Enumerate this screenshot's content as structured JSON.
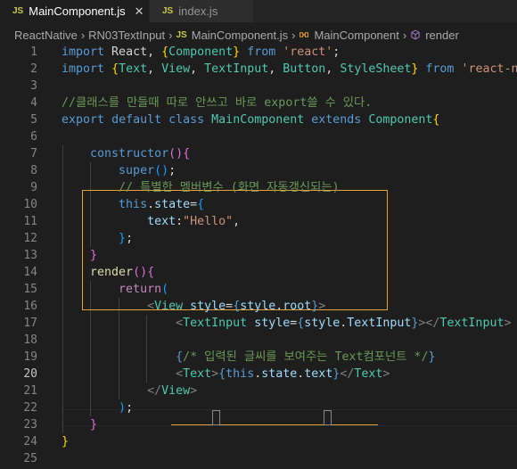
{
  "tabs": [
    {
      "label": "MainComponent.js",
      "icon": "js-file-icon",
      "badge": "JS",
      "active": true
    },
    {
      "label": "index.js",
      "icon": "js-file-icon",
      "badge": "JS",
      "active": false
    }
  ],
  "breadcrumb": {
    "items": [
      "ReactNative",
      "RN03TextInput",
      "MainComponent.js",
      "MainComponent",
      "render"
    ],
    "js_badge": "JS"
  },
  "colors": {
    "background": "#1e1e1e",
    "keyword": "#569cd6",
    "control": "#c586c0",
    "string": "#ce9178",
    "class": "#4ec9b0",
    "function": "#dcdcaa",
    "variable": "#9cdcfe",
    "comment": "#6a9955",
    "highlight_border": "#e5a33a"
  },
  "current_line": 20,
  "lines": [
    {
      "n": 1,
      "tokens": [
        [
          "kw",
          "import"
        ],
        [
          "pl",
          " React, "
        ],
        [
          "brk",
          "{"
        ],
        [
          "cls",
          "Component"
        ],
        [
          "brk",
          "}"
        ],
        [
          "pl",
          " "
        ],
        [
          "kw",
          "from"
        ],
        [
          "pl",
          " "
        ],
        [
          "str",
          "'react'"
        ],
        [
          "pl",
          ";"
        ]
      ]
    },
    {
      "n": 2,
      "tokens": [
        [
          "kw",
          "import"
        ],
        [
          "pl",
          " "
        ],
        [
          "brk",
          "{"
        ],
        [
          "cls",
          "Text"
        ],
        [
          "pl",
          ", "
        ],
        [
          "cls",
          "View"
        ],
        [
          "pl",
          ", "
        ],
        [
          "cls",
          "TextInput"
        ],
        [
          "pl",
          ", "
        ],
        [
          "cls",
          "Button"
        ],
        [
          "pl",
          ", "
        ],
        [
          "cls",
          "StyleSheet"
        ],
        [
          "brk",
          "}"
        ],
        [
          "pl",
          " "
        ],
        [
          "kw",
          "from"
        ],
        [
          "pl",
          " "
        ],
        [
          "str",
          "'react-nati"
        ]
      ]
    },
    {
      "n": 3,
      "tokens": []
    },
    {
      "n": 4,
      "tokens": [
        [
          "cmt",
          "//클래스를 만들때 따로 안쓰고 바로 export쓸 수 있다."
        ]
      ]
    },
    {
      "n": 5,
      "tokens": [
        [
          "kw",
          "export"
        ],
        [
          "pl",
          " "
        ],
        [
          "kw",
          "default"
        ],
        [
          "pl",
          " "
        ],
        [
          "kw",
          "class"
        ],
        [
          "pl",
          " "
        ],
        [
          "cls",
          "MainComponent"
        ],
        [
          "pl",
          " "
        ],
        [
          "kw",
          "extends"
        ],
        [
          "pl",
          " "
        ],
        [
          "cls",
          "Component"
        ],
        [
          "brk",
          "{"
        ]
      ]
    },
    {
      "n": 6,
      "tokens": []
    },
    {
      "n": 7,
      "tokens": [
        [
          "pl",
          "    "
        ],
        [
          "kw",
          "constructor"
        ],
        [
          "brk2",
          "()"
        ],
        [
          "brk2",
          "{"
        ]
      ]
    },
    {
      "n": 8,
      "tokens": [
        [
          "pl",
          "        "
        ],
        [
          "kw",
          "super"
        ],
        [
          "brk3",
          "()"
        ],
        [
          "pl",
          ";"
        ]
      ]
    },
    {
      "n": 9,
      "tokens": [
        [
          "pl",
          "        "
        ],
        [
          "cmt",
          "// 특별한 멤버변수 (화면 자동갱신되는)"
        ]
      ]
    },
    {
      "n": 10,
      "tokens": [
        [
          "pl",
          "        "
        ],
        [
          "kw",
          "this"
        ],
        [
          "pl",
          "."
        ],
        [
          "var",
          "state"
        ],
        [
          "pl",
          "="
        ],
        [
          "brk3",
          "{"
        ]
      ]
    },
    {
      "n": 11,
      "tokens": [
        [
          "pl",
          "            "
        ],
        [
          "var",
          "text"
        ],
        [
          "pl",
          ":"
        ],
        [
          "str",
          "\"Hello\""
        ],
        [
          "pl",
          ","
        ]
      ]
    },
    {
      "n": 12,
      "tokens": [
        [
          "pl",
          "        "
        ],
        [
          "brk3",
          "}"
        ],
        [
          "pl",
          ";"
        ]
      ]
    },
    {
      "n": 13,
      "tokens": [
        [
          "pl",
          "    "
        ],
        [
          "brk2",
          "}"
        ]
      ]
    },
    {
      "n": 14,
      "tokens": [
        [
          "pl",
          "    "
        ],
        [
          "fn",
          "render"
        ],
        [
          "brk2",
          "()"
        ],
        [
          "brk2",
          "{"
        ]
      ]
    },
    {
      "n": 15,
      "tokens": [
        [
          "pl",
          "        "
        ],
        [
          "ctl",
          "return"
        ],
        [
          "brk3",
          "("
        ]
      ]
    },
    {
      "n": 16,
      "tokens": [
        [
          "pl",
          "            "
        ],
        [
          "tag",
          "<"
        ],
        [
          "cls",
          "View"
        ],
        [
          "pl",
          " "
        ],
        [
          "var",
          "style"
        ],
        [
          "pl",
          "="
        ],
        [
          "kw",
          "{"
        ],
        [
          "var",
          "style"
        ],
        [
          "pl",
          "."
        ],
        [
          "var",
          "root"
        ],
        [
          "kw",
          "}"
        ],
        [
          "tag",
          ">"
        ]
      ]
    },
    {
      "n": 17,
      "tokens": [
        [
          "pl",
          "                "
        ],
        [
          "tag",
          "<"
        ],
        [
          "cls",
          "TextInput"
        ],
        [
          "pl",
          " "
        ],
        [
          "var",
          "style"
        ],
        [
          "pl",
          "="
        ],
        [
          "kw",
          "{"
        ],
        [
          "var",
          "style"
        ],
        [
          "pl",
          "."
        ],
        [
          "var",
          "TextInput"
        ],
        [
          "kw",
          "}"
        ],
        [
          "tag",
          "></"
        ],
        [
          "cls",
          "TextInput"
        ],
        [
          "tag",
          ">"
        ]
      ]
    },
    {
      "n": 18,
      "tokens": []
    },
    {
      "n": 19,
      "tokens": [
        [
          "pl",
          "                "
        ],
        [
          "kw",
          "{"
        ],
        [
          "cmt",
          "/* 입력된 글씨를 보여주는 Text컴포넌트 */"
        ],
        [
          "kw",
          "}"
        ]
      ]
    },
    {
      "n": 20,
      "tokens": [
        [
          "pl",
          "                "
        ],
        [
          "tag",
          "<"
        ],
        [
          "cls",
          "Text"
        ],
        [
          "tag",
          ">"
        ],
        [
          "kw",
          "{"
        ],
        [
          "kw",
          "this"
        ],
        [
          "pl",
          "."
        ],
        [
          "var",
          "state"
        ],
        [
          "pl",
          "."
        ],
        [
          "var",
          "text"
        ],
        [
          "kw",
          "}"
        ],
        [
          "tag",
          "</"
        ],
        [
          "cls",
          "Text"
        ],
        [
          "tag",
          ">"
        ]
      ]
    },
    {
      "n": 21,
      "tokens": [
        [
          "pl",
          "            "
        ],
        [
          "tag",
          "</"
        ],
        [
          "cls",
          "View"
        ],
        [
          "tag",
          ">"
        ]
      ]
    },
    {
      "n": 22,
      "tokens": [
        [
          "pl",
          "        "
        ],
        [
          "brk3",
          ")"
        ],
        [
          "pl",
          ";"
        ]
      ]
    },
    {
      "n": 23,
      "tokens": [
        [
          "pl",
          "    "
        ],
        [
          "brk2",
          "}"
        ]
      ]
    },
    {
      "n": 24,
      "tokens": [
        [
          "brk",
          "}"
        ]
      ]
    },
    {
      "n": 25,
      "tokens": []
    }
  ]
}
